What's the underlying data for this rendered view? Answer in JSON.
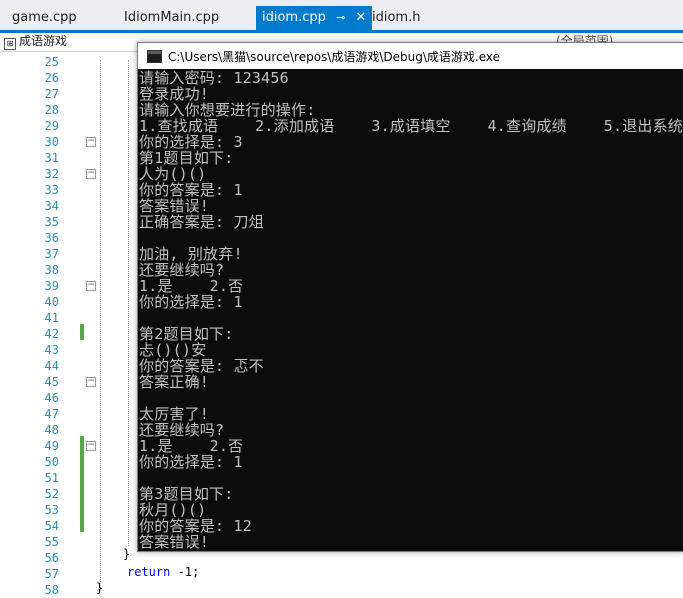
{
  "tabs": [
    {
      "label": "game.cpp",
      "active": false
    },
    {
      "label": "IdiomMain.cpp",
      "active": false
    },
    {
      "label": "idiom.cpp",
      "active": true
    },
    {
      "label": "idiom.h",
      "active": false
    }
  ],
  "nav": {
    "project": "成语游戏",
    "scope": "(全局范围)"
  },
  "line_numbers": [
    "25",
    "26",
    "27",
    "28",
    "29",
    "30",
    "31",
    "32",
    "33",
    "34",
    "35",
    "36",
    "37",
    "38",
    "39",
    "40",
    "41",
    "42",
    "43",
    "44",
    "45",
    "46",
    "47",
    "48",
    "49",
    "50",
    "51",
    "52",
    "53",
    "54",
    "55",
    "56",
    "57",
    "58"
  ],
  "code": {
    "brace_close_inner": "}",
    "return_kw": "return",
    "return_val": " -1;",
    "brace_close_outer": "}"
  },
  "console": {
    "title": "C:\\Users\\黑猫\\source\\repos\\成语游戏\\Debug\\成语游戏.exe",
    "lines": [
      "请输入密码: 123456",
      "登录成功!",
      "请输入你想要进行的操作:",
      "1.查找成语    2.添加成语    3.成语填空    4.查询成绩    5.退出系统",
      "你的选择是: 3",
      "第1题目如下:",
      "人为()()",
      "你的答案是: 1",
      "答案错误!",
      "正确答案是: 刀俎",
      "",
      "加油, 别放弃!",
      "还要继续吗?",
      "1.是    2.否",
      "你的选择是: 1",
      "",
      "第2题目如下:",
      "忐()()安",
      "你的答案是: 忑不",
      "答案正确!",
      "",
      "太厉害了!",
      "还要继续吗?",
      "1.是    2.否",
      "你的选择是: 1",
      "",
      "第3题目如下:",
      "秋月()()",
      "你的答案是: 12",
      "答案错误!"
    ]
  },
  "colors": {
    "accent": "#007acc",
    "change_marker": "#57a64a",
    "console_bg": "#0c0c0c",
    "console_text": "#c0c0c0",
    "line_number": "#2b91af",
    "keyword": "#0000ff"
  }
}
